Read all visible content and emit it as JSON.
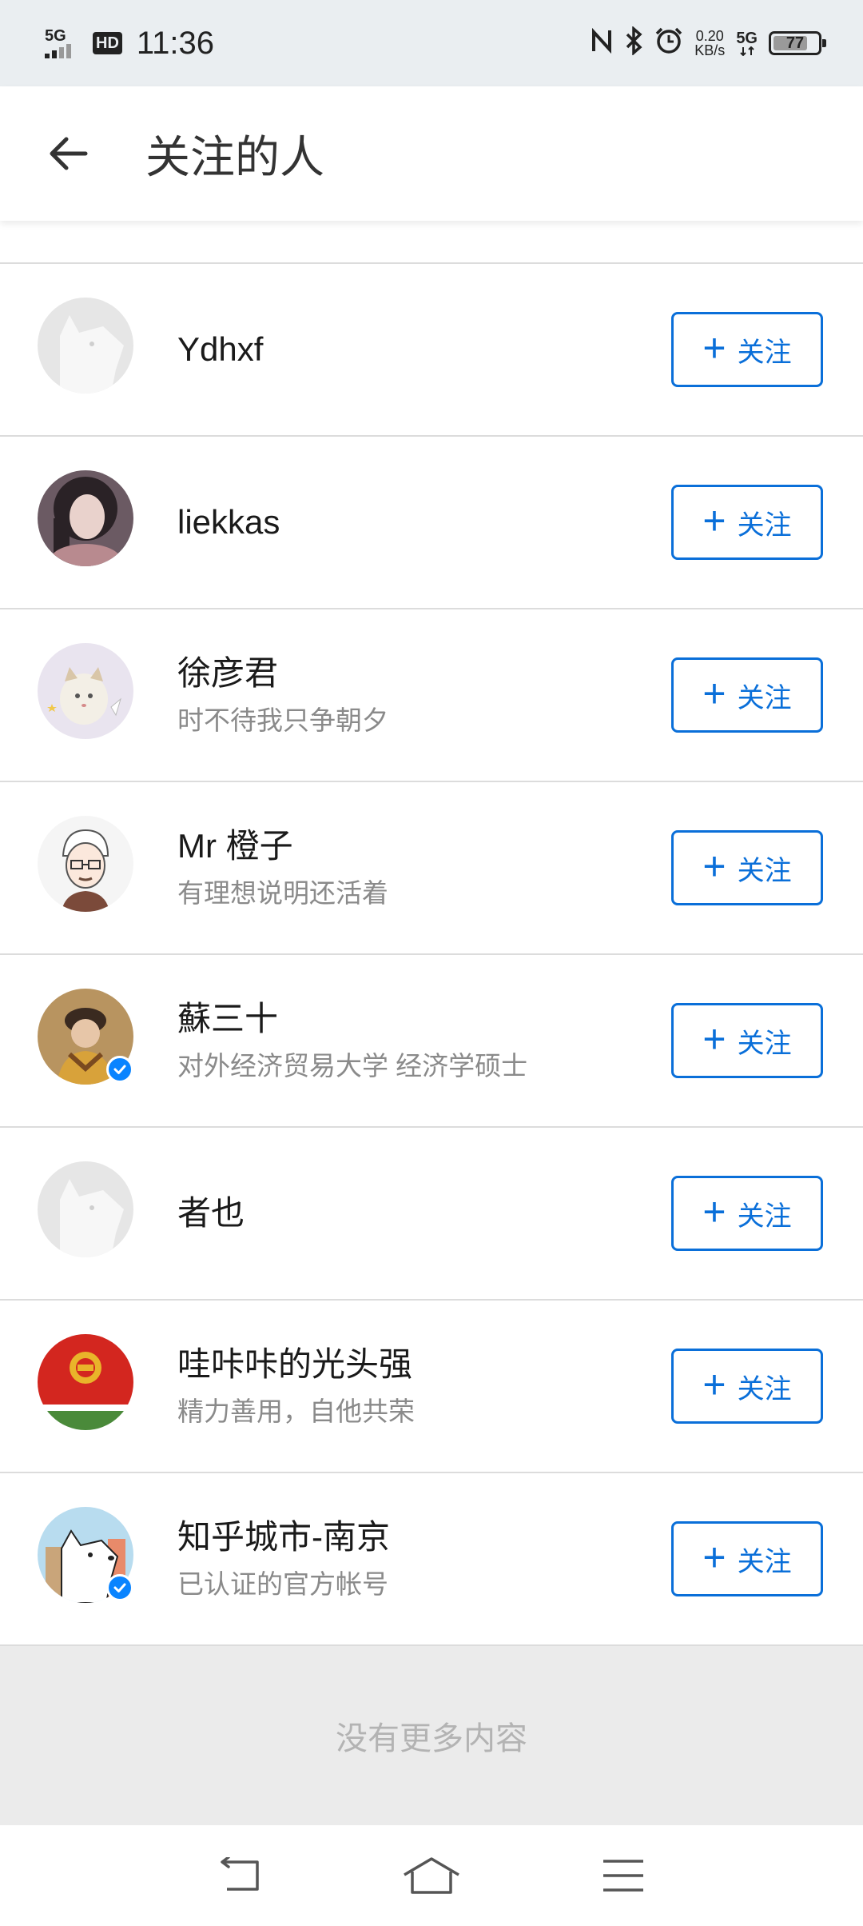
{
  "status_bar": {
    "network": "5G",
    "hd": "HD",
    "time": "11:36",
    "speed_value": "0.20",
    "speed_unit": "KB/s",
    "network2": "5G",
    "battery": "77",
    "battery_level": 0.77
  },
  "header": {
    "title": "关注的人"
  },
  "follow_label": "关注",
  "follow_plus": "+",
  "users": [
    {
      "name": "Ydhxf",
      "subtitle": ""
    },
    {
      "name": "liekkas",
      "subtitle": ""
    },
    {
      "name": "徐彦君",
      "subtitle": "时不待我只争朝夕"
    },
    {
      "name": "Mr 橙子",
      "subtitle": "有理想说明还活着"
    },
    {
      "name": "蘇三十",
      "subtitle": "对外经济贸易大学 经济学硕士"
    },
    {
      "name": "者也",
      "subtitle": ""
    },
    {
      "name": "哇咔咔的光头强",
      "subtitle": "精力善用，自他共荣"
    },
    {
      "name": "知乎城市-南京",
      "subtitle": "已认证的官方帐号"
    }
  ],
  "footer": {
    "text": "没有更多内容"
  },
  "colors": {
    "accent": "#0a6fd9",
    "status_bar_bg": "#eaeef1",
    "footer_bg": "#ebebeb",
    "verified_badge": "#0a84ff"
  }
}
